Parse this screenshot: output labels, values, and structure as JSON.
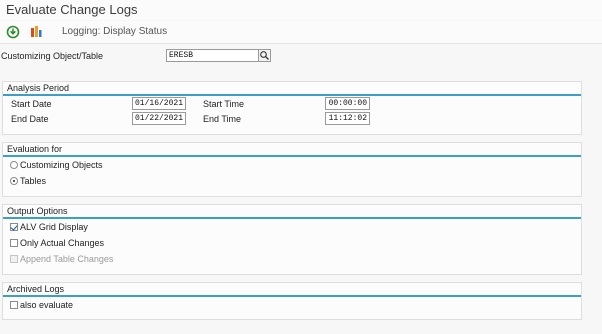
{
  "window": {
    "title": "Evaluate Change Logs"
  },
  "toolbar": {
    "execute_icon": "execute-icon",
    "logging_icon": "logging-icon",
    "logging_text": "Logging: Display Status"
  },
  "customizing": {
    "label": "Customizing Object/Table",
    "value": "ERESB",
    "help_icon": "search-help-icon"
  },
  "analysis_period": {
    "title": "Analysis Period",
    "start_date_label": "Start Date",
    "start_date": "01/16/2021",
    "start_time_label": "Start Time",
    "start_time": "00:00:00",
    "end_date_label": "End Date",
    "end_date": "01/22/2021",
    "end_time_label": "End Time",
    "end_time": "11:12:02"
  },
  "evaluation_for": {
    "title": "Evaluation for",
    "options": [
      {
        "label": "Customizing Objects",
        "selected": false
      },
      {
        "label": "Tables",
        "selected": true
      }
    ]
  },
  "output_options": {
    "title": "Output Options",
    "options": [
      {
        "label": "ALV Grid Display",
        "checked": true,
        "enabled": true
      },
      {
        "label": "Only Actual Changes",
        "checked": false,
        "enabled": true
      },
      {
        "label": "Append Table Changes",
        "checked": false,
        "enabled": false
      }
    ]
  },
  "archived_logs": {
    "title": "Archived Logs",
    "options": [
      {
        "label": "also evaluate",
        "checked": false
      }
    ]
  },
  "colors": {
    "accent": "#3aa0c8",
    "panel": "#fcfcfc",
    "background": "#f7f7f7"
  }
}
